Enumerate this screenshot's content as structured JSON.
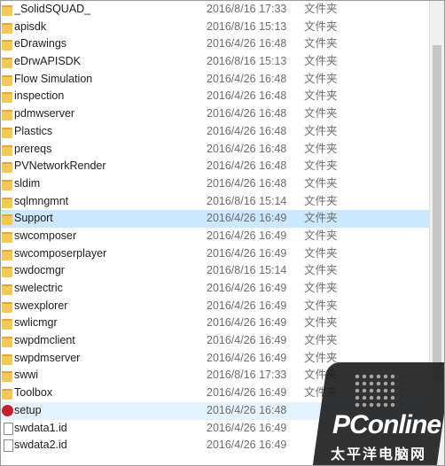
{
  "rows": [
    {
      "name": "_SolidSQUAD_",
      "date": "2016/8/16 17:33",
      "type": "文件夹",
      "icon": "folder-icon",
      "state": "normal"
    },
    {
      "name": "apisdk",
      "date": "2016/8/16 15:13",
      "type": "文件夹",
      "icon": "folder-icon",
      "state": "normal"
    },
    {
      "name": "eDrawings",
      "date": "2016/4/26 16:48",
      "type": "文件夹",
      "icon": "folder-icon",
      "state": "normal"
    },
    {
      "name": "eDrwAPISDK",
      "date": "2016/8/16 15:13",
      "type": "文件夹",
      "icon": "folder-icon",
      "state": "normal"
    },
    {
      "name": "Flow Simulation",
      "date": "2016/4/26 16:48",
      "type": "文件夹",
      "icon": "folder-icon",
      "state": "normal"
    },
    {
      "name": "inspection",
      "date": "2016/4/26 16:48",
      "type": "文件夹",
      "icon": "folder-icon",
      "state": "normal"
    },
    {
      "name": "pdmwserver",
      "date": "2016/4/26 16:48",
      "type": "文件夹",
      "icon": "folder-icon",
      "state": "normal"
    },
    {
      "name": "Plastics",
      "date": "2016/4/26 16:48",
      "type": "文件夹",
      "icon": "folder-icon",
      "state": "normal"
    },
    {
      "name": "prereqs",
      "date": "2016/4/26 16:48",
      "type": "文件夹",
      "icon": "folder-icon",
      "state": "normal"
    },
    {
      "name": "PVNetworkRender",
      "date": "2016/4/26 16:48",
      "type": "文件夹",
      "icon": "folder-icon",
      "state": "normal"
    },
    {
      "name": "sldim",
      "date": "2016/4/26 16:48",
      "type": "文件夹",
      "icon": "folder-icon",
      "state": "normal"
    },
    {
      "name": "sqlmngmnt",
      "date": "2016/8/16 15:14",
      "type": "文件夹",
      "icon": "folder-icon",
      "state": "normal"
    },
    {
      "name": "Support",
      "date": "2016/4/26 16:49",
      "type": "文件夹",
      "icon": "folder-icon",
      "state": "selected"
    },
    {
      "name": "swcomposer",
      "date": "2016/4/26 16:49",
      "type": "文件夹",
      "icon": "folder-icon",
      "state": "normal"
    },
    {
      "name": "swcomposerplayer",
      "date": "2016/4/26 16:49",
      "type": "文件夹",
      "icon": "folder-icon",
      "state": "normal"
    },
    {
      "name": "swdocmgr",
      "date": "2016/8/16 15:14",
      "type": "文件夹",
      "icon": "folder-icon",
      "state": "normal"
    },
    {
      "name": "swelectric",
      "date": "2016/4/26 16:49",
      "type": "文件夹",
      "icon": "folder-icon",
      "state": "normal"
    },
    {
      "name": "swexplorer",
      "date": "2016/4/26 16:49",
      "type": "文件夹",
      "icon": "folder-icon",
      "state": "normal"
    },
    {
      "name": "swlicmgr",
      "date": "2016/4/26 16:49",
      "type": "文件夹",
      "icon": "folder-icon",
      "state": "normal"
    },
    {
      "name": "swpdmclient",
      "date": "2016/4/26 16:49",
      "type": "文件夹",
      "icon": "folder-icon",
      "state": "normal"
    },
    {
      "name": "swpdmserver",
      "date": "2016/4/26 16:49",
      "type": "文件夹",
      "icon": "folder-icon",
      "state": "normal"
    },
    {
      "name": "swwi",
      "date": "2016/8/16 17:33",
      "type": "文件夹",
      "icon": "folder-icon",
      "state": "normal"
    },
    {
      "name": "Toolbox",
      "date": "2016/4/26 16:49",
      "type": "文件夹",
      "icon": "folder-icon",
      "state": "normal"
    },
    {
      "name": "setup",
      "date": "2016/4/26 16:48",
      "type": "",
      "icon": "solidworks-setup-icon",
      "state": "hover"
    },
    {
      "name": "swdata1.id",
      "date": "2016/4/26 16:49",
      "type": "",
      "icon": "file-icon",
      "state": "normal"
    },
    {
      "name": "swdata2.id",
      "date": "2016/4/26 16:49",
      "type": "",
      "icon": "file-icon",
      "state": "normal"
    }
  ],
  "watermark": {
    "logo_text_a": "PC",
    "logo_text_b": "online",
    "logo_cn": "太平洋电脑网"
  },
  "colors": {
    "selected": "#cce8ff",
    "hover": "#e5f3ff",
    "folder": "#f3c955",
    "meta_text": "#6d6d6d"
  }
}
